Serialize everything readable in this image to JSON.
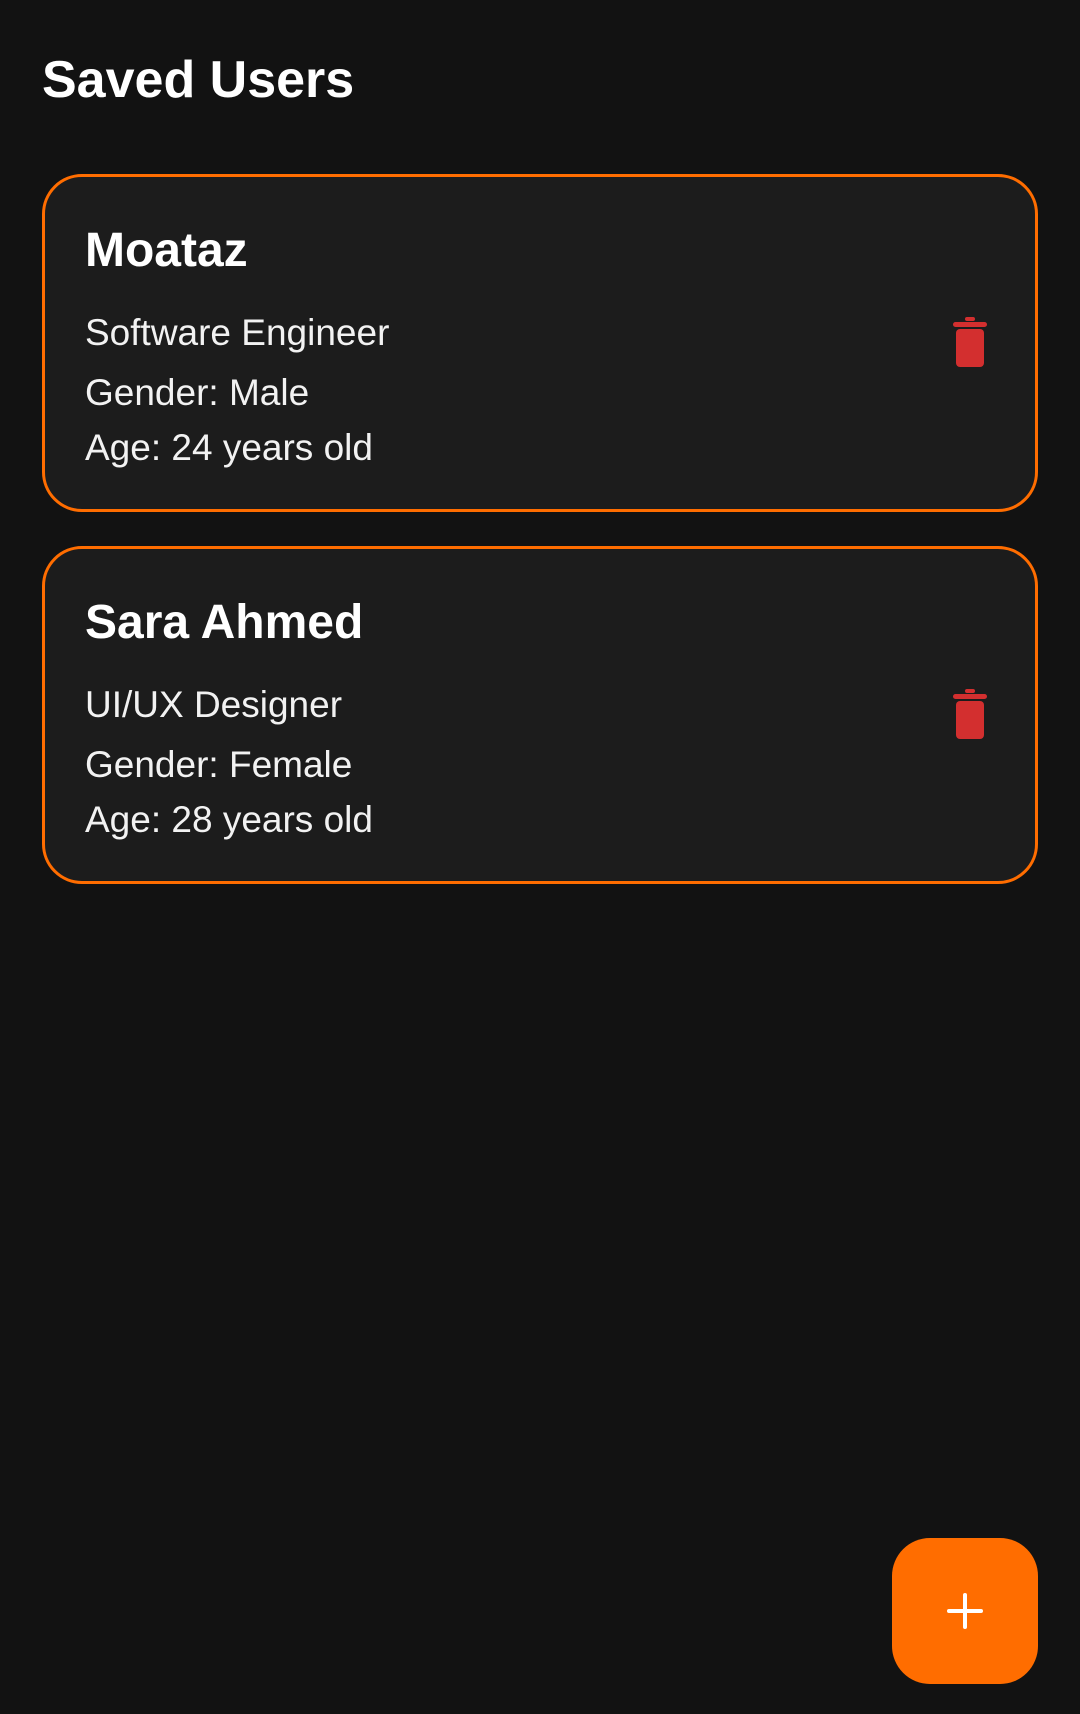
{
  "header": {
    "title": "Saved Users"
  },
  "users": [
    {
      "name": "Moataz",
      "role": "Software Engineer",
      "gender": "Gender: Male",
      "age": "Age: 24 years old"
    },
    {
      "name": "Sara Ahmed",
      "role": "UI/UX Designer",
      "gender": "Gender: Female",
      "age": "Age: 28 years old"
    }
  ],
  "icons": {
    "delete": "trash-icon",
    "add": "plus-icon"
  },
  "colors": {
    "background": "#121212",
    "card_background": "#1c1c1c",
    "accent": "#ff6d00",
    "delete": "#d32f2f",
    "text": "#ffffff"
  }
}
